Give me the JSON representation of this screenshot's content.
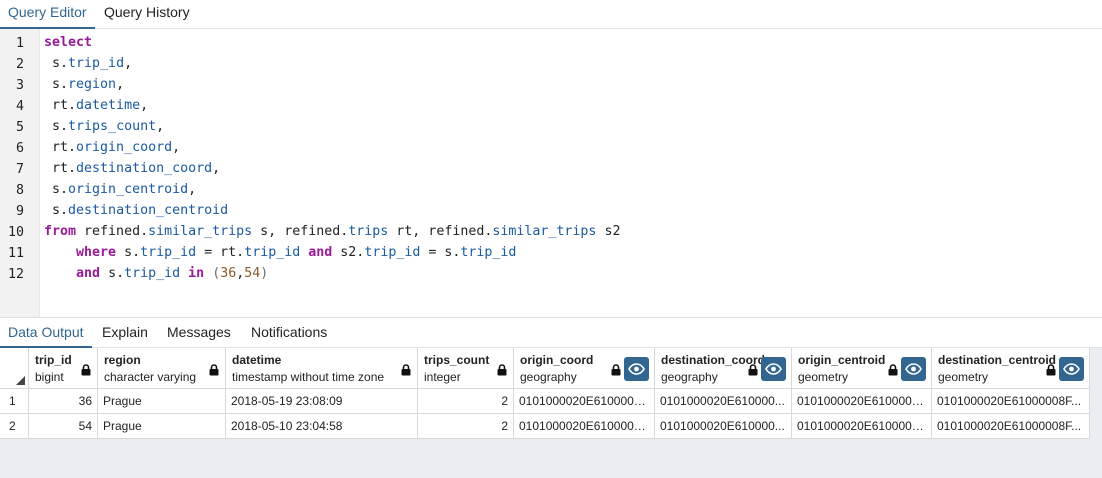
{
  "top_tabs": [
    {
      "label": "Query Editor",
      "active": true
    },
    {
      "label": "Query History",
      "active": false
    }
  ],
  "editor": {
    "line_numbers": [
      "1",
      "2",
      "3",
      "4",
      "5",
      "6",
      "7",
      "8",
      "9",
      "10",
      "11",
      "12"
    ]
  },
  "bottom_tabs": [
    {
      "label": "Data Output",
      "active": true
    },
    {
      "label": "Explain",
      "active": false
    },
    {
      "label": "Messages",
      "active": false
    },
    {
      "label": "Notifications",
      "active": false
    }
  ],
  "grid": {
    "columns": [
      {
        "name": "trip_id",
        "type": "bigint",
        "locked": true,
        "viewer": false
      },
      {
        "name": "region",
        "type": "character varying",
        "locked": true,
        "viewer": false
      },
      {
        "name": "datetime",
        "type": "timestamp without time zone",
        "locked": true,
        "viewer": false
      },
      {
        "name": "trips_count",
        "type": "integer",
        "locked": true,
        "viewer": false
      },
      {
        "name": "origin_coord",
        "type": "geography",
        "locked": true,
        "viewer": true
      },
      {
        "name": "destination_coord",
        "type": "geography",
        "locked": true,
        "viewer": true
      },
      {
        "name": "origin_centroid",
        "type": "geometry",
        "locked": true,
        "viewer": true
      },
      {
        "name": "destination_centroid",
        "type": "geometry",
        "locked": true,
        "viewer": true
      }
    ],
    "rows": [
      {
        "num": "1",
        "cells": [
          "36",
          "Prague",
          "2018-05-19 23:08:09",
          "2",
          "0101000020E6100000...",
          "0101000020E610000...",
          "0101000020E6100000...",
          "0101000020E61000008F..."
        ]
      },
      {
        "num": "2",
        "cells": [
          "54",
          "Prague",
          "2018-05-10 23:04:58",
          "2",
          "0101000020E6100000...",
          "0101000020E610000...",
          "0101000020E6100000...",
          "0101000020E61000008F..."
        ]
      }
    ]
  },
  "colors": {
    "accent": "#326690",
    "keyword": "#9a1a9a",
    "identifier": "#1a5aa0",
    "number": "#8a5a2a"
  },
  "icons": [
    "lock-icon",
    "eye-icon",
    "sort-corner-icon"
  ]
}
